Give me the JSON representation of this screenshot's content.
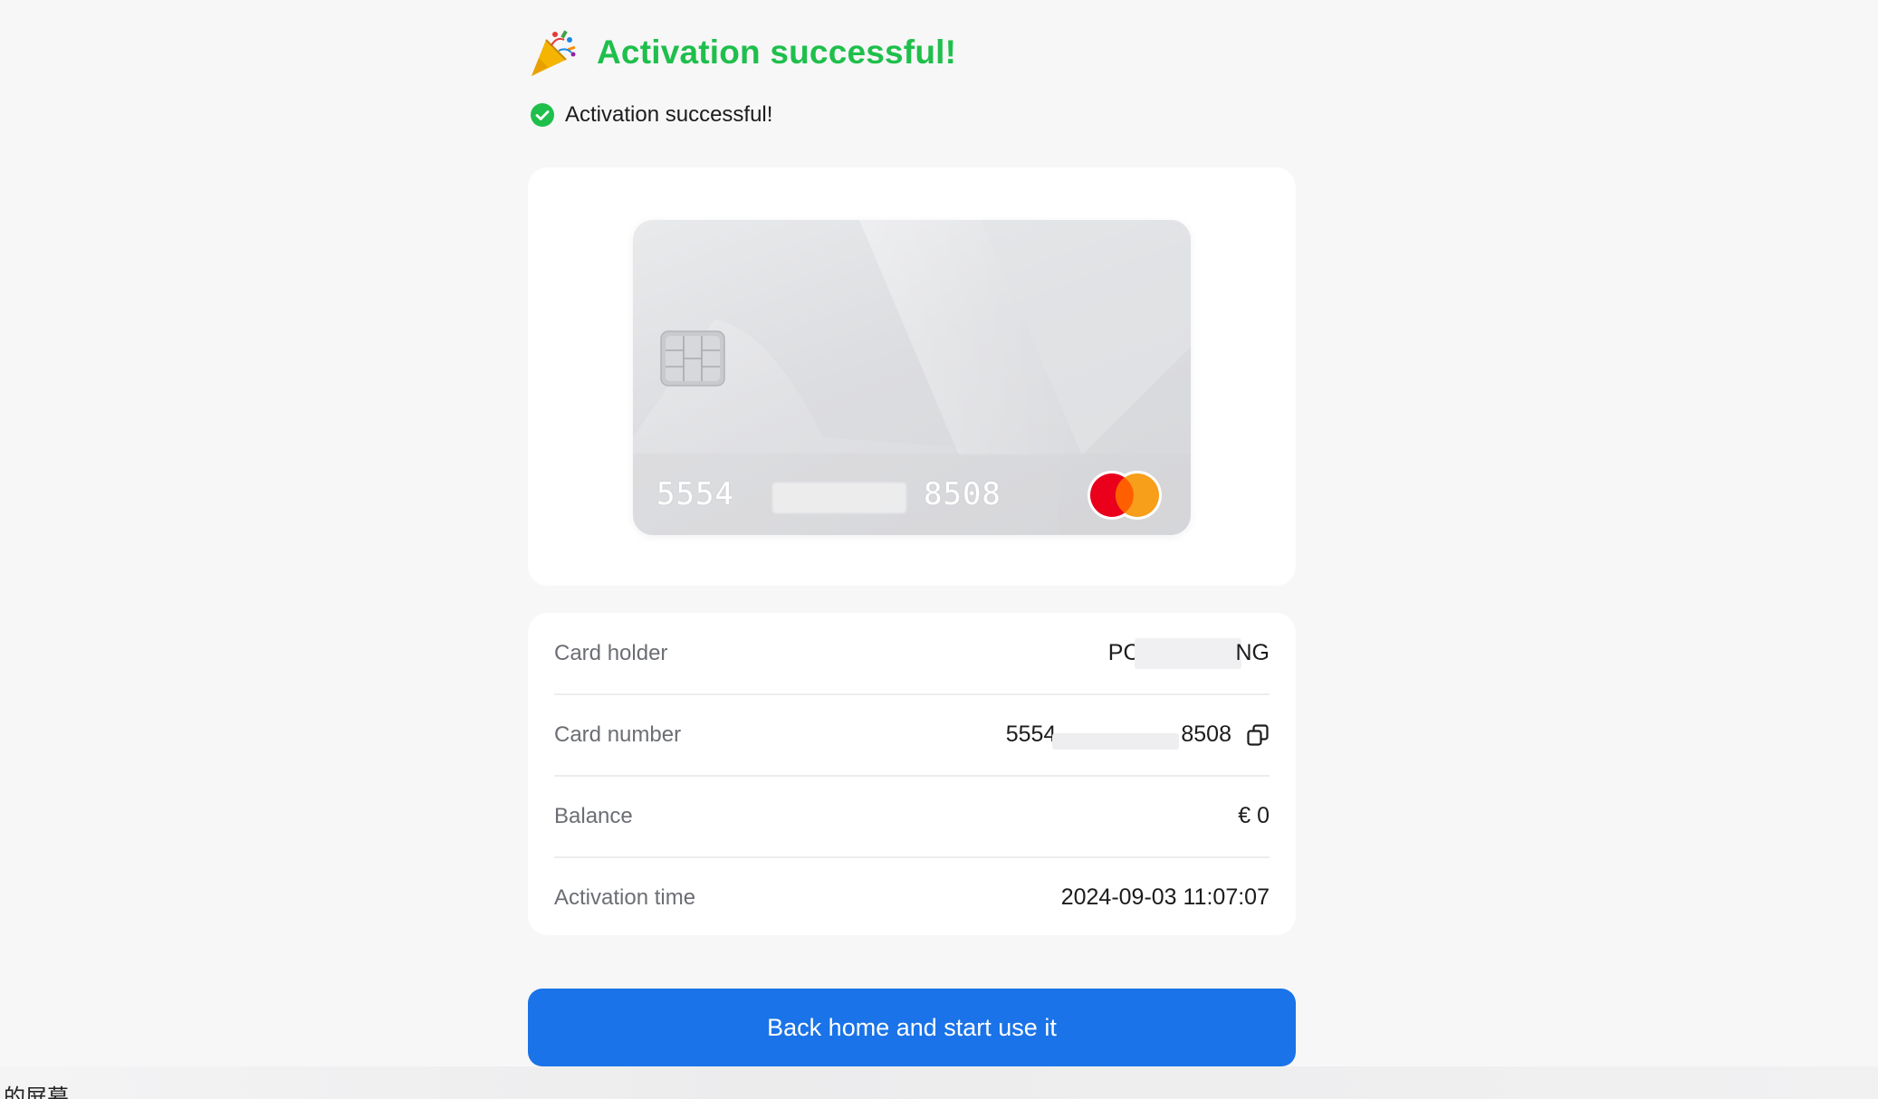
{
  "header": {
    "title": "Activation successful!",
    "icon": "party-popper-icon"
  },
  "status": {
    "text": "Activation successful!",
    "icon": "check-circle-icon",
    "color": "#1fbf4b"
  },
  "card": {
    "number_start": "5554",
    "number_end": "8508",
    "brand": "mastercard"
  },
  "details": {
    "card_holder": {
      "label": "Card holder",
      "value_start": "PC",
      "value_end": "NG"
    },
    "card_number": {
      "label": "Card number",
      "value_start": "5554",
      "value_end": "8508"
    },
    "balance": {
      "label": "Balance",
      "value": "€ 0"
    },
    "activation_time": {
      "label": "Activation time",
      "value": "2024-09-03 11:07:07"
    }
  },
  "actions": {
    "primary_label": "Back home and start use it"
  },
  "footer": {
    "caption": "的屏幕"
  },
  "colors": {
    "accent": "#1a73e8",
    "success": "#1fbf4b",
    "mastercard_red": "#eb001b",
    "mastercard_orange": "#f79e1b"
  }
}
